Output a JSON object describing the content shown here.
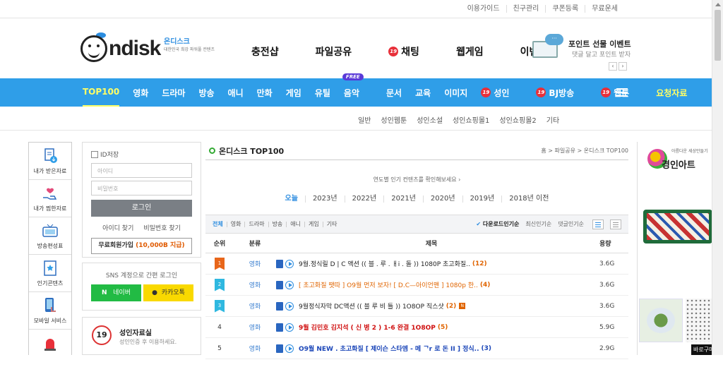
{
  "top_links": [
    "이용가이드",
    "친구관리",
    "쿠폰등록",
    "무료운세"
  ],
  "logo": {
    "word": "ndisk",
    "kr": "온디스크",
    "tagline": "대한민국 최강 파워풀 컨텐츠"
  },
  "main_nav": [
    {
      "label": "충전샵",
      "badge": ""
    },
    {
      "label": "파일공유",
      "badge": ""
    },
    {
      "label": "채팅",
      "badge": "19"
    },
    {
      "label": "웹게임",
      "badge": ""
    },
    {
      "label": "이벤트",
      "badge": ""
    }
  ],
  "promo": {
    "bubble": "···",
    "title": "포인트 선물 이벤트",
    "subtitle": "댓글 달고 포인트 받자",
    "prev": "‹",
    "next": "›"
  },
  "categories": [
    {
      "label": "TOP100",
      "state": "active"
    },
    {
      "label": "영화"
    },
    {
      "label": "드라마"
    },
    {
      "label": "방송"
    },
    {
      "label": "애니"
    },
    {
      "label": "만화"
    },
    {
      "label": "게임"
    },
    {
      "label": "유틸"
    },
    {
      "label": "음악",
      "tag": "FREE"
    },
    {
      "label": "문서"
    },
    {
      "label": "교육"
    },
    {
      "label": "이미지"
    },
    {
      "label": "성인",
      "badge": "19"
    },
    {
      "label": "BJ방송",
      "badge": "19"
    },
    {
      "label": "웹툰",
      "badge": "19"
    },
    {
      "label": "요청자료",
      "state": "highlight"
    }
  ],
  "sub_nav": [
    "일반",
    "성인웹툰",
    "성인소설",
    "성인쇼핑몰1",
    "성인쇼핑몰2",
    "기타"
  ],
  "left_rail": [
    "내가 받은자료",
    "내가 찜한자료",
    "방송편성표",
    "인기콘텐츠",
    "모바일 서비스"
  ],
  "login": {
    "save_id": "ID저장",
    "id_placeholder": "아이디",
    "pw_placeholder": "비밀번호",
    "login_button": "로그인",
    "find_id": "아이디 찾기",
    "find_pw": "비밀번호 찾기",
    "join_prefix": "무료회원가입",
    "join_bonus": "(10,000B 지급)"
  },
  "sns": {
    "title": "SNS 계정으로 간편 로그인",
    "naver": "네이버",
    "kakao": "카카오톡"
  },
  "adult_box": {
    "badge": "19",
    "title": "성인자료실",
    "subtitle": "성인인증 후 이용하세요."
  },
  "main": {
    "title": "온디스크 TOP100",
    "breadcrumb": "홈 > 파일공유 > 온디스크 TOP100",
    "hint": "연도별 인기 컨텐츠를 확인해보세요 ›",
    "years": [
      "오늘",
      "2023년",
      "2022년",
      "2021년",
      "2020년",
      "2019년",
      "2018년 이전"
    ],
    "filter_tabs": [
      "전체",
      "영화",
      "드라마",
      "방송",
      "애니",
      "게임",
      "기타"
    ],
    "sorts": [
      "다운로드인기순",
      "최신인기순",
      "댓글인기순"
    ],
    "headers": {
      "rank": "순위",
      "category": "분류",
      "title": "제목",
      "size": "용량"
    },
    "rows": [
      {
        "rank": "1",
        "medal": "#e8661a",
        "category": "영화",
        "title": "9월.정식릴 D | C 액션 (( 블 . 루 . ㅐi . 돌 )) 1080P 초고화질..",
        "count": "(12)",
        "style": "black",
        "new": "",
        "size": "3.6G"
      },
      {
        "rank": "2",
        "medal": "#2fb8e0",
        "category": "영화",
        "title": "[ 초고화질 땟따 ] O9월 먼저 보자! [ D.C—아이언맨 ] 1080p 한..",
        "count": "(4)",
        "style": "orange",
        "new": "",
        "size": "3.6G"
      },
      {
        "rank": "3",
        "medal": "#2fb8e0",
        "category": "영화",
        "title": "9월정식자막 DC액션 (( 블 루 비 틀 )) 1O8OP 직스샷",
        "count": "(2)",
        "style": "black",
        "new": "N",
        "size": "3.6G"
      },
      {
        "rank": "4",
        "medal": "",
        "category": "영화",
        "title": "9월 김민호 김지석 ( 신 병 2 ) 1-6 완결 1O8OP",
        "count": "(5)",
        "style": "red",
        "new": "",
        "size": "5.9G"
      },
      {
        "rank": "5",
        "medal": "",
        "category": "영화",
        "title": "O9월 NEW . 초고화질 [ 제이슨 스타엠 - 메 ᄀr 로 돈 II ] 정식..",
        "count": "(3)",
        "style": "blue",
        "new": "",
        "size": "2.9G"
      }
    ]
  },
  "right_ad": {
    "small": "아름다운 세상만들기",
    "brand": "경인아트",
    "corner": "바로구매",
    "close": "ⓘ"
  }
}
